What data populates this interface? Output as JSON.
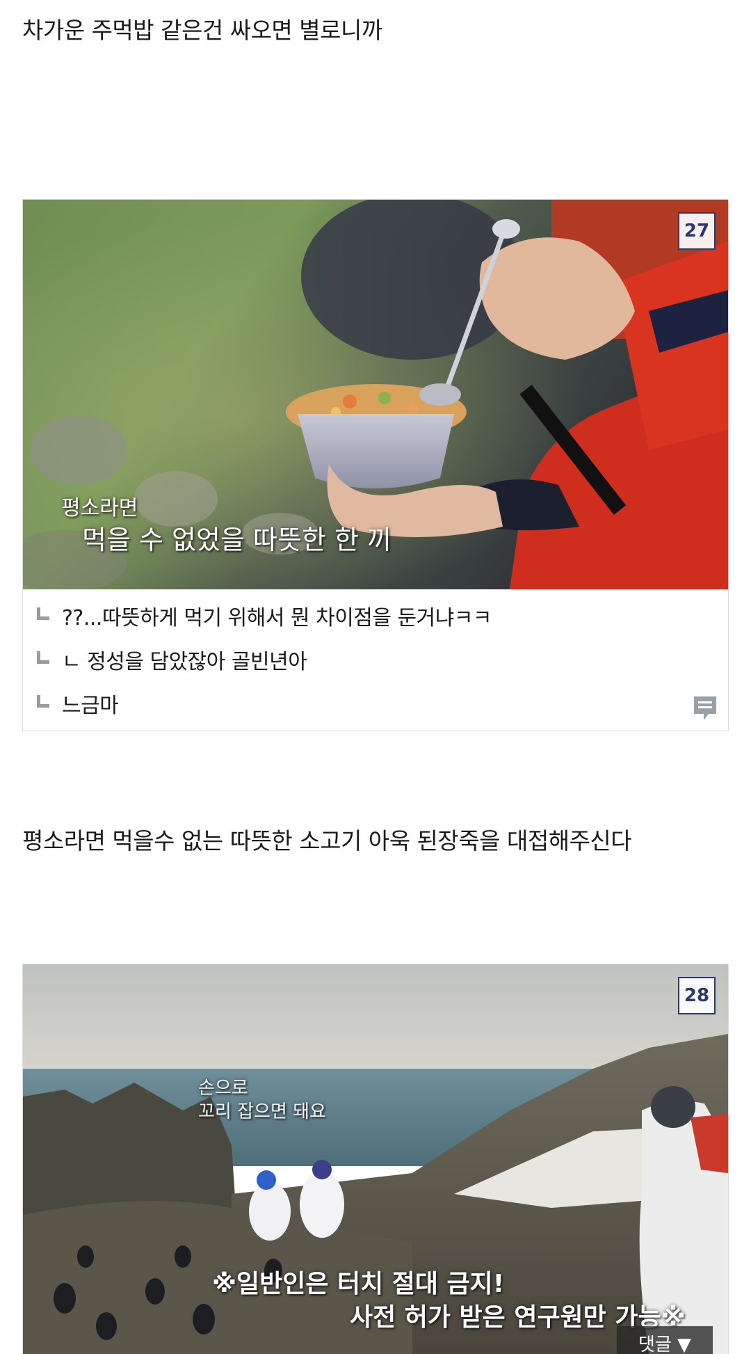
{
  "paragraphs": [
    "차가운 주먹밥 같은건 싸오면 별로니까",
    "평소라면 먹을수 없는 따뜻한 소고기 아욱 된장죽을 대접해주신다"
  ],
  "cards": [
    {
      "number": "27",
      "caption_line1": "평소라면",
      "caption_line2": "먹을 수 없었을 따뜻한 한 끼",
      "comments": [
        "??...따뜻하게 먹기 위해서 뭔 차이점을 둔거냐ㅋㅋ",
        "ㄴ 정성을 담았잖아 골빈년아",
        "느금마"
      ],
      "comment_icon": "comment-bubble-icon"
    },
    {
      "number": "28",
      "caption_top1": "손으로",
      "caption_top2": "꼬리 잡으면 돼요",
      "caption_bottom1": "※일반인은 터치 절대 금지!",
      "caption_bottom2": "사전 허가 받은 연구원만 가능※",
      "toggle_label": "댓글 ▼"
    }
  ],
  "colors": {
    "badge": "#283a6e",
    "text": "#1a1a1a",
    "border": "#dcdcdc"
  }
}
